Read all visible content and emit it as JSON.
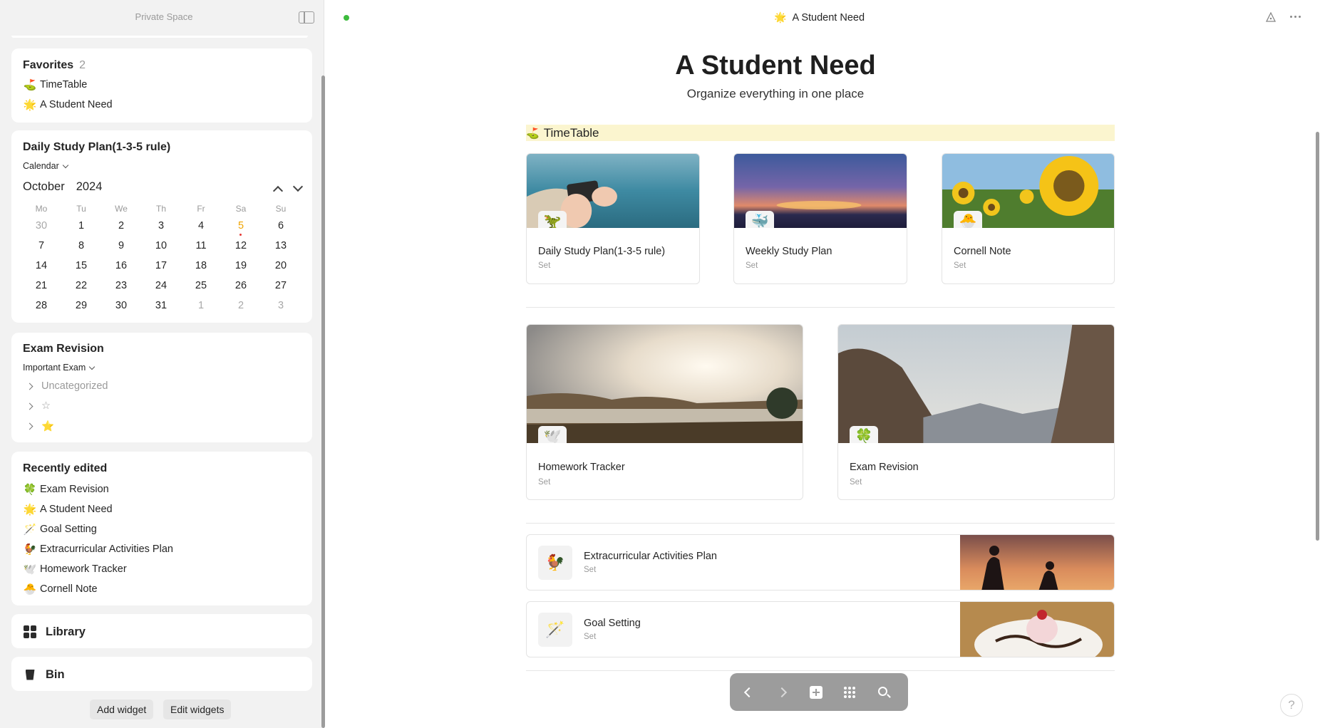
{
  "sidebar": {
    "space_name": "Private Space",
    "favorites": {
      "title": "Favorites",
      "count": "2",
      "items": [
        {
          "emoji": "⛳",
          "label": "TimeTable"
        },
        {
          "emoji": "🌟",
          "label": "A Student Need"
        }
      ]
    },
    "calendar_widget": {
      "title": "Daily Study Plan(1-3-5 rule)",
      "view": "Calendar",
      "month": "October",
      "year": "2024",
      "weekdays": [
        "Mo",
        "Tu",
        "We",
        "Th",
        "Fr",
        "Sa",
        "Su"
      ],
      "days": [
        "30",
        "1",
        "2",
        "3",
        "4",
        "5",
        "6",
        "7",
        "8",
        "9",
        "10",
        "11",
        "12",
        "13",
        "14",
        "15",
        "16",
        "17",
        "18",
        "19",
        "20",
        "21",
        "22",
        "23",
        "24",
        "25",
        "26",
        "27",
        "28",
        "29",
        "30",
        "31",
        "1",
        "2",
        "3"
      ],
      "muted_days_indices": [
        0,
        32,
        33,
        34
      ],
      "today_index": 5
    },
    "exam_widget": {
      "title": "Exam Revision",
      "view": "Important Exam",
      "groups": [
        {
          "label": "Uncategorized"
        },
        {
          "label": "☆"
        },
        {
          "label": "⭐"
        }
      ]
    },
    "recent": {
      "title": "Recently edited",
      "items": [
        {
          "emoji": "🍀",
          "label": "Exam Revision"
        },
        {
          "emoji": "🌟",
          "label": "A Student Need"
        },
        {
          "emoji": "🪄",
          "label": "Goal Setting"
        },
        {
          "emoji": "🐓",
          "label": "Extracurricular Activities Plan"
        },
        {
          "emoji": "🕊️",
          "label": "Homework Tracker"
        },
        {
          "emoji": "🐣",
          "label": "Cornell Note"
        }
      ]
    },
    "library_label": "Library",
    "bin_label": "Bin",
    "add_widget_label": "Add widget",
    "edit_widgets_label": "Edit widgets"
  },
  "header": {
    "emoji": "🌟",
    "title": "A Student Need"
  },
  "page": {
    "title": "A Student Need",
    "subtitle": "Organize everything in one place",
    "highlight": {
      "emoji": "⛳",
      "label": "TimeTable"
    },
    "cards_row1": [
      {
        "emoji": "🦖",
        "name": "Daily Study Plan(1-3-5 rule)",
        "type": "Set"
      },
      {
        "emoji": "🐳",
        "name": "Weekly Study Plan",
        "type": "Set"
      },
      {
        "emoji": "🐣",
        "name": "Cornell Note",
        "type": "Set"
      }
    ],
    "cards_row2": [
      {
        "emoji": "🕊️",
        "name": "Homework Tracker",
        "type": "Set"
      },
      {
        "emoji": "🍀",
        "name": "Exam Revision",
        "type": "Set"
      }
    ],
    "list_cards": [
      {
        "emoji": "🐓",
        "name": "Extracurricular Activities Plan",
        "type": "Set"
      },
      {
        "emoji": "🪄",
        "name": "Goal Setting",
        "type": "Set"
      }
    ]
  },
  "help_label": "?",
  "icons": {
    "sidebar_toggle": "sidebar-toggle-icon",
    "graph": "graph-icon",
    "more": "more-icon",
    "back": "chevron-left-icon",
    "forward": "chevron-right-icon",
    "new": "plus-square-icon",
    "widgets": "dots-grid-icon",
    "search": "search-icon"
  },
  "colors": {
    "sync_dot": "#3dbb3d",
    "highlight_bg": "#fbf5cf",
    "today": "#f0a400"
  }
}
